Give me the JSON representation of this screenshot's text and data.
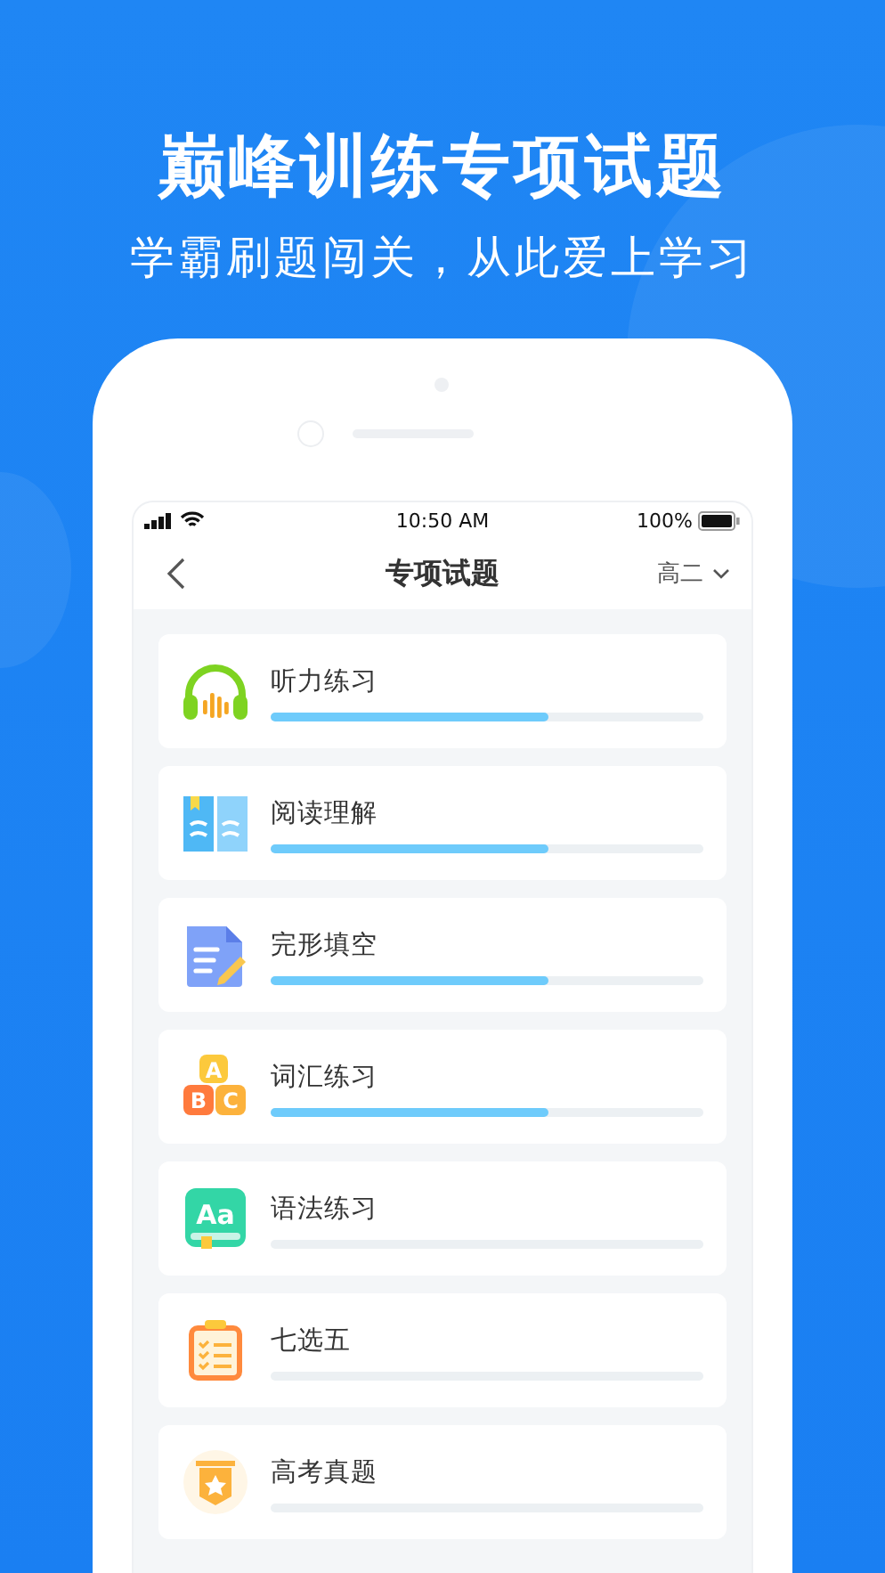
{
  "headline": "巅峰训练专项试题",
  "subtitle": "学霸刷题闯关，从此爱上学习",
  "status_bar": {
    "time": "10:50 AM",
    "battery": "100%"
  },
  "nav": {
    "title": "专项试题",
    "grade": "高二"
  },
  "items": [
    {
      "kind": "headphones",
      "label": "听力练习",
      "level": 0.64
    },
    {
      "kind": "book",
      "label": "阅读理解",
      "level": 0.64
    },
    {
      "kind": "document",
      "label": "完形填空",
      "level": 0.64
    },
    {
      "kind": "blocks",
      "label": "词汇练习",
      "level": 0.64,
      "icon_text": [
        "A",
        "B",
        "C"
      ]
    },
    {
      "kind": "grammar",
      "label": "语法练习",
      "icon_text": [
        "Aa"
      ]
    },
    {
      "kind": "checklist",
      "label": "七选五"
    },
    {
      "kind": "badge",
      "label": "高考真题"
    }
  ]
}
